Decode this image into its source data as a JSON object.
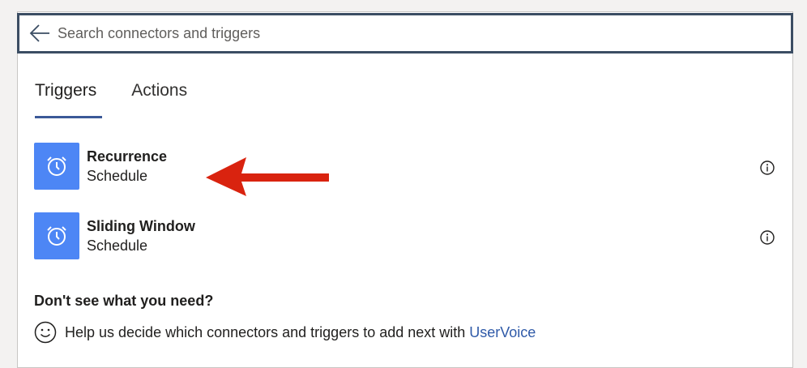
{
  "search": {
    "placeholder": "Search connectors and triggers",
    "value": ""
  },
  "tabs": [
    {
      "label": "Triggers",
      "active": true
    },
    {
      "label": "Actions",
      "active": false
    }
  ],
  "items": [
    {
      "title": "Recurrence",
      "subtitle": "Schedule",
      "icon": "alarm-clock-icon"
    },
    {
      "title": "Sliding Window",
      "subtitle": "Schedule",
      "icon": "alarm-clock-icon"
    }
  ],
  "help": {
    "heading": "Don't see what you need?",
    "text": "Help us decide which connectors and triggers to add next with",
    "link": "UserVoice"
  },
  "colors": {
    "accent": "#3b5998",
    "icon_bg": "#4d86f5",
    "arrow": "#d9230f",
    "link": "#2f5aa8"
  }
}
